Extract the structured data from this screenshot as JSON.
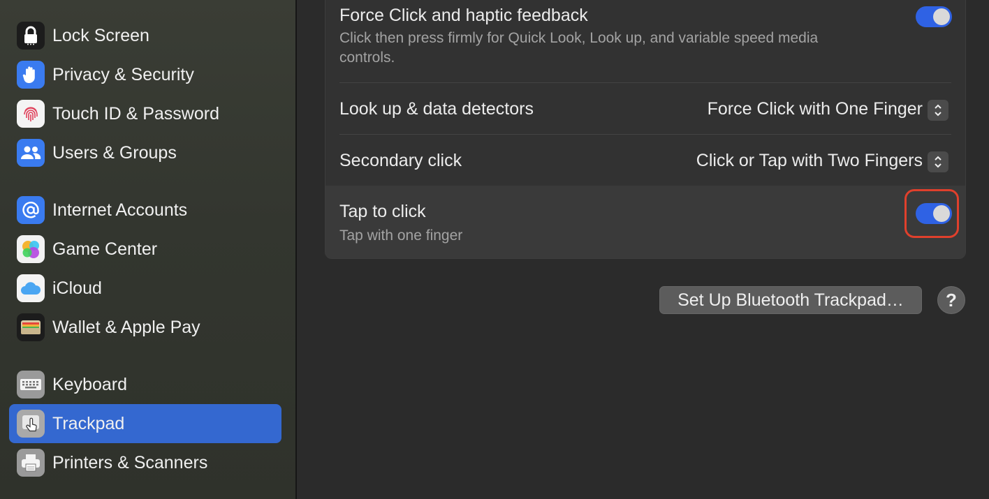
{
  "sidebar": {
    "items": [
      {
        "label": "Lock Screen",
        "icon": "lock-icon"
      },
      {
        "label": "Privacy & Security",
        "icon": "hand-icon"
      },
      {
        "label": "Touch ID & Password",
        "icon": "fingerprint-icon"
      },
      {
        "label": "Users & Groups",
        "icon": "users-icon"
      },
      {
        "label": "Internet Accounts",
        "icon": "at-icon"
      },
      {
        "label": "Game Center",
        "icon": "game-center-icon"
      },
      {
        "label": "iCloud",
        "icon": "cloud-icon"
      },
      {
        "label": "Wallet & Apple Pay",
        "icon": "wallet-icon"
      },
      {
        "label": "Keyboard",
        "icon": "keyboard-icon"
      },
      {
        "label": "Trackpad",
        "icon": "trackpad-icon",
        "selected": true
      },
      {
        "label": "Printers & Scanners",
        "icon": "printer-icon"
      }
    ]
  },
  "settings": {
    "force_click": {
      "title": "Force Click and haptic feedback",
      "subtitle": "Click then press firmly for Quick Look, Look up, and variable speed media controls.",
      "enabled": true
    },
    "look_up": {
      "title": "Look up & data detectors",
      "value": "Force Click with One Finger"
    },
    "secondary_click": {
      "title": "Secondary click",
      "value": "Click or Tap with Two Fingers"
    },
    "tap_to_click": {
      "title": "Tap to click",
      "subtitle": "Tap with one finger",
      "enabled": true
    }
  },
  "footer": {
    "bluetooth_button": "Set Up Bluetooth Trackpad…",
    "help_label": "?"
  },
  "colors": {
    "accent": "#2f62e4",
    "selection": "#3468d0",
    "highlight_outline": "#e0402c"
  }
}
